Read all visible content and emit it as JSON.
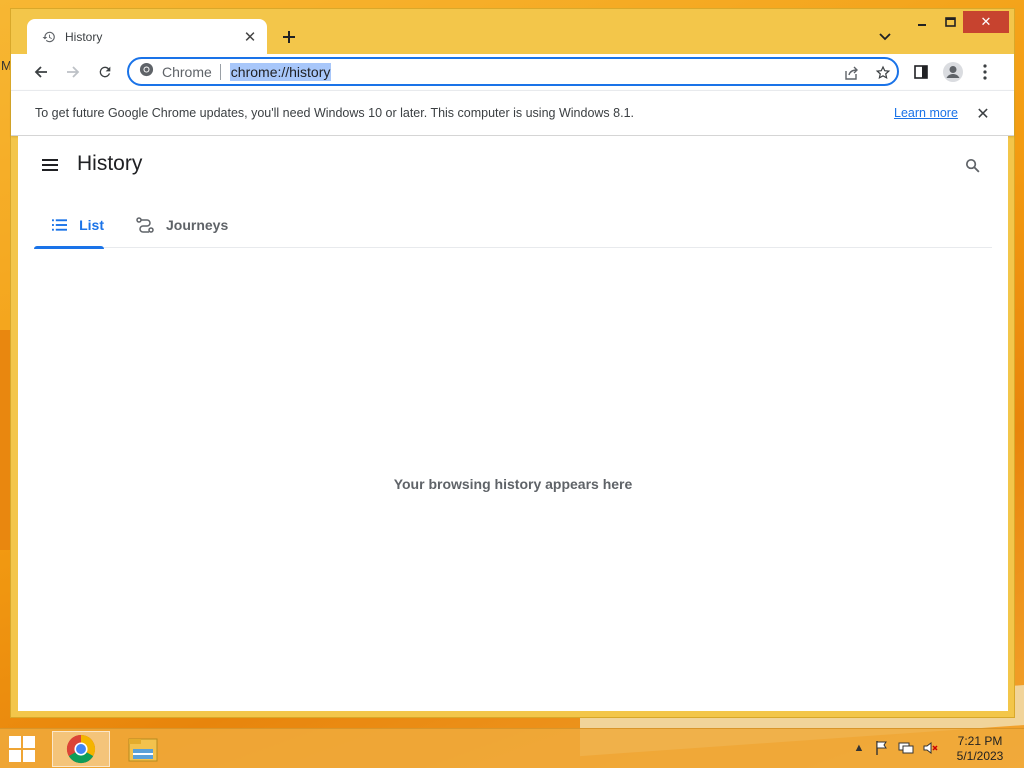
{
  "desktop": {
    "edge_letter": "M"
  },
  "browser": {
    "tab": {
      "title": "History",
      "close_label": "✕",
      "new_tab_label": "+"
    },
    "window_controls": {
      "minimize": "–",
      "maximize": "□",
      "close": "✕"
    },
    "omnibox": {
      "site_label": "Chrome",
      "url": "chrome://history"
    },
    "infobar": {
      "message": "To get future Google Chrome updates, you'll need Windows 10 or later. This computer is using Windows 8.1.",
      "link": "Learn more",
      "close": "✕"
    }
  },
  "page": {
    "title": "History",
    "tabs": [
      {
        "label": "List",
        "selected": true
      },
      {
        "label": "Journeys",
        "selected": false
      }
    ],
    "empty_message": "Your browsing history appears here"
  },
  "taskbar": {
    "clock": {
      "time": "7:21 PM",
      "date": "5/1/2023"
    },
    "tray_arrow": "▲"
  },
  "colors": {
    "accent": "#1a73e8",
    "window_frame": "#f3c64a",
    "close_red": "#c7432f"
  }
}
